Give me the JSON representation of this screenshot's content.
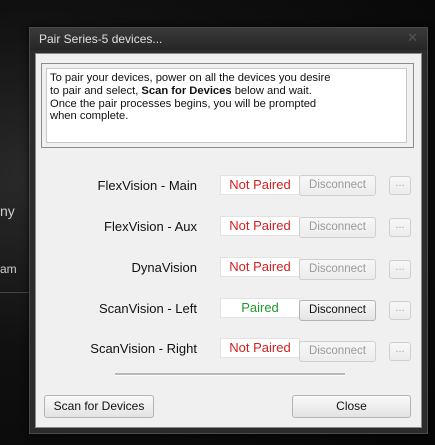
{
  "background": {
    "fragment_1": "ny",
    "fragment_2": "am"
  },
  "window": {
    "title": "Pair Series-5 devices...",
    "close_glyph": "✕"
  },
  "instructions": {
    "line1": "To pair your devices, power on all the devices you desire",
    "line2_pre": "to pair and select, ",
    "line2_bold": "Scan for Devices",
    "line2_post": " below and wait.",
    "line3": "Once the pair processes begins, you will be prompted",
    "line4": "when complete."
  },
  "devices": [
    {
      "name": "FlexVision - Main",
      "status": "Not Paired",
      "disconnect": "Disconnect",
      "more": "...",
      "enabled": false
    },
    {
      "name": "FlexVision - Aux",
      "status": "Not Paired",
      "disconnect": "Disconnect",
      "more": "...",
      "enabled": false
    },
    {
      "name": "DynaVision",
      "status": "Not Paired",
      "disconnect": "Disconnect",
      "more": "...",
      "enabled": false
    },
    {
      "name": "ScanVision - Left",
      "status": "Paired",
      "disconnect": "Disconnect",
      "more": "...",
      "enabled": true
    },
    {
      "name": "ScanVision - Right",
      "status": "Not Paired",
      "disconnect": "Disconnect",
      "more": "...",
      "enabled": false
    }
  ],
  "footer": {
    "scan_label": "Scan for Devices",
    "close_label": "Close"
  },
  "colors": {
    "not_paired": "#d61e1e",
    "paired": "#1f9a2a"
  }
}
